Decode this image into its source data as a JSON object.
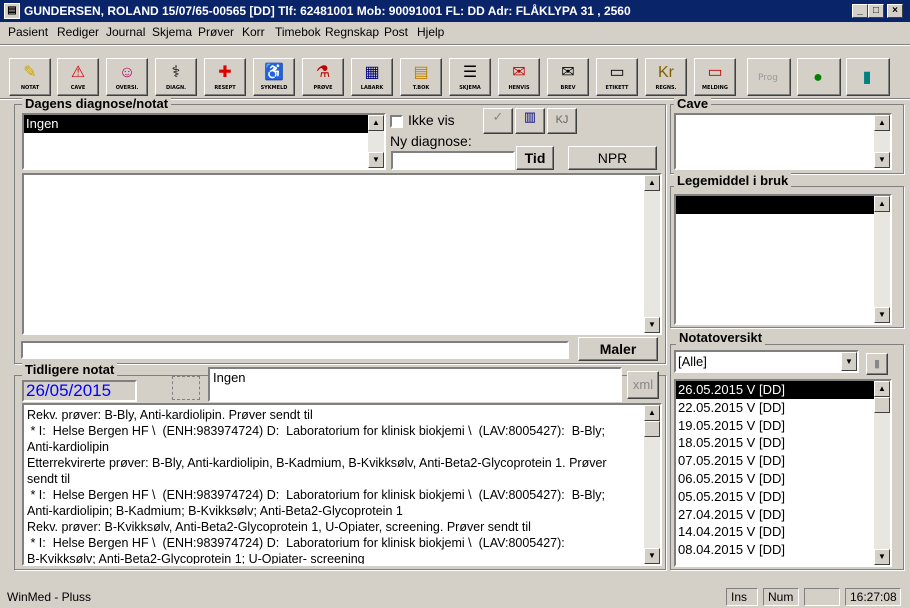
{
  "title": "GUNDERSEN, ROLAND 15/07/65-00565 [DD] Tlf: 62481001 Mob: 90091001 FL: DD Adr: FLÅKLYPA 31 , 2560",
  "menu": [
    "Pasient",
    "Rediger",
    "Journal",
    "Skjema",
    "Prøver",
    "Korr",
    "Timebok",
    "Regnskap",
    "Post",
    "Hjelp"
  ],
  "toolbar": [
    {
      "label": "NOTAT",
      "icon": "✎",
      "color": "#c9a400"
    },
    {
      "label": "CAVE",
      "icon": "⚠",
      "color": "#d40000"
    },
    {
      "label": "OVERSI.",
      "icon": "☺",
      "color": "#b00060"
    },
    {
      "label": "DIAGN.",
      "icon": "⚕",
      "color": "#000"
    },
    {
      "label": "RESEPT",
      "icon": "✚",
      "color": "#e00000"
    },
    {
      "label": "SYKMELD",
      "icon": "♿",
      "color": "#000080"
    },
    {
      "label": "PRØVE",
      "icon": "⚗",
      "color": "#c00000"
    },
    {
      "label": "LABARK",
      "icon": "▦",
      "color": "#000080"
    },
    {
      "label": "T.BOK",
      "icon": "▤",
      "color": "#c08000"
    },
    {
      "label": "SKJEMA",
      "icon": "☰",
      "color": "#000"
    },
    {
      "label": "HENVIS",
      "icon": "✉",
      "color": "#c00000"
    },
    {
      "label": "BREV",
      "icon": "✉",
      "color": "#000"
    },
    {
      "label": "ETIKETT",
      "icon": "▭",
      "color": "#000"
    },
    {
      "label": "REGNS.",
      "icon": "Kr",
      "color": "#806000"
    },
    {
      "label": "MELDING",
      "icon": "▭",
      "color": "#c00000"
    },
    {
      "label": "Prog",
      "icon": "",
      "color": "#999"
    },
    {
      "label": "",
      "icon": "●",
      "color": "#008000"
    },
    {
      "label": "",
      "icon": "▮",
      "color": "#008080"
    }
  ],
  "diagnose": {
    "group_label": "Dagens diagnose/notat",
    "list": [
      "Ingen"
    ],
    "ikke_vis_label": "Ikke vis",
    "ny_diagnose_label": "Ny diagnose:",
    "ny_diagnose_value": "",
    "tid_button": "Tid",
    "npr_button": "NPR",
    "kj_button": "KJ",
    "maler_button": "Maler",
    "note_text": "",
    "maler_input": ""
  },
  "cave": {
    "group_label": "Cave",
    "items": []
  },
  "legemiddel": {
    "group_label": "Legemiddel i bruk",
    "items": []
  },
  "notatoversikt": {
    "group_label": "Notatoversikt",
    "filter_value": "[Alle]",
    "items": [
      "26.05.2015 V [DD]",
      "22.05.2015 V [DD]",
      "19.05.2015 V [DD]",
      "18.05.2015 V [DD]",
      "07.05.2015 V [DD]",
      "06.05.2015 V [DD]",
      "05.05.2015 V [DD]",
      "27.04.2015 V [DD]",
      "14.04.2015 V [DD]",
      "08.04.2015 V [DD]"
    ],
    "selected_index": 0
  },
  "tidligere": {
    "group_label": "Tidligere notat",
    "date": "26/05/2015",
    "diagnose": "Ingen",
    "xml_button": "xml",
    "lines": [
      "Rekv. prøver: B-Bly, Anti-kardiolipin. Prøver sendt til",
      " * I:  Helse Bergen HF \\  (ENH:983974724) D:  Laboratorium for klinisk biokjemi \\  (LAV:8005427):  B-Bly;",
      "Anti-kardiolipin",
      "Etterrekvirerte prøver: B-Bly, Anti-kardiolipin, B-Kadmium, B-Kvikksølv, Anti-Beta2-Glycoprotein 1. Prøver",
      "sendt til",
      " * I:  Helse Bergen HF \\  (ENH:983974724) D:  Laboratorium for klinisk biokjemi \\  (LAV:8005427):  B-Bly;",
      "Anti-kardiolipin; B-Kadmium; B-Kvikksølv; Anti-Beta2-Glycoprotein 1",
      "Rekv. prøver: B-Kvikksølv, Anti-Beta2-Glycoprotein 1, U-Opiater, screening. Prøver sendt til",
      " * I:  Helse Bergen HF \\  (ENH:983974724) D:  Laboratorium for klinisk biokjemi \\  (LAV:8005427):",
      "B-Kvikksølv; Anti-Beta2-Glycoprotein 1; U-Opiater- screening"
    ]
  },
  "status": {
    "app": "WinMed - Pluss",
    "ins": "Ins",
    "num": "Num",
    "time": "16:27:08"
  }
}
